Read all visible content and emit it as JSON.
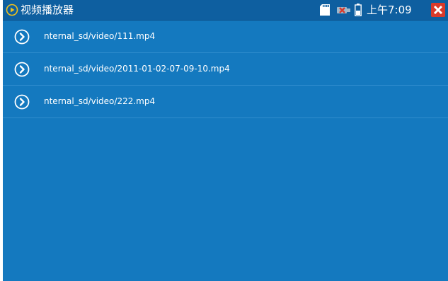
{
  "colors": {
    "background": "#1479bf",
    "titlebar": "#0e5fa0",
    "close": "#d93a2b",
    "accent_icon": "#f2c21a"
  },
  "titlebar": {
    "app_icon": "play-circle-icon",
    "title": "视频播放器"
  },
  "status": {
    "sd_icon": "sd-card-icon",
    "usb_icon": "usb-disconnected-icon",
    "battery_icon": "battery-icon",
    "time": "上午7:09",
    "close_icon": "close-icon"
  },
  "files": [
    {
      "icon": "play-arrow-circle-icon",
      "path": "nternal_sd/video/111.mp4"
    },
    {
      "icon": "play-arrow-circle-icon",
      "path": "nternal_sd/video/2011-01-02-07-09-10.mp4"
    },
    {
      "icon": "play-arrow-circle-icon",
      "path": "nternal_sd/video/222.mp4"
    }
  ]
}
